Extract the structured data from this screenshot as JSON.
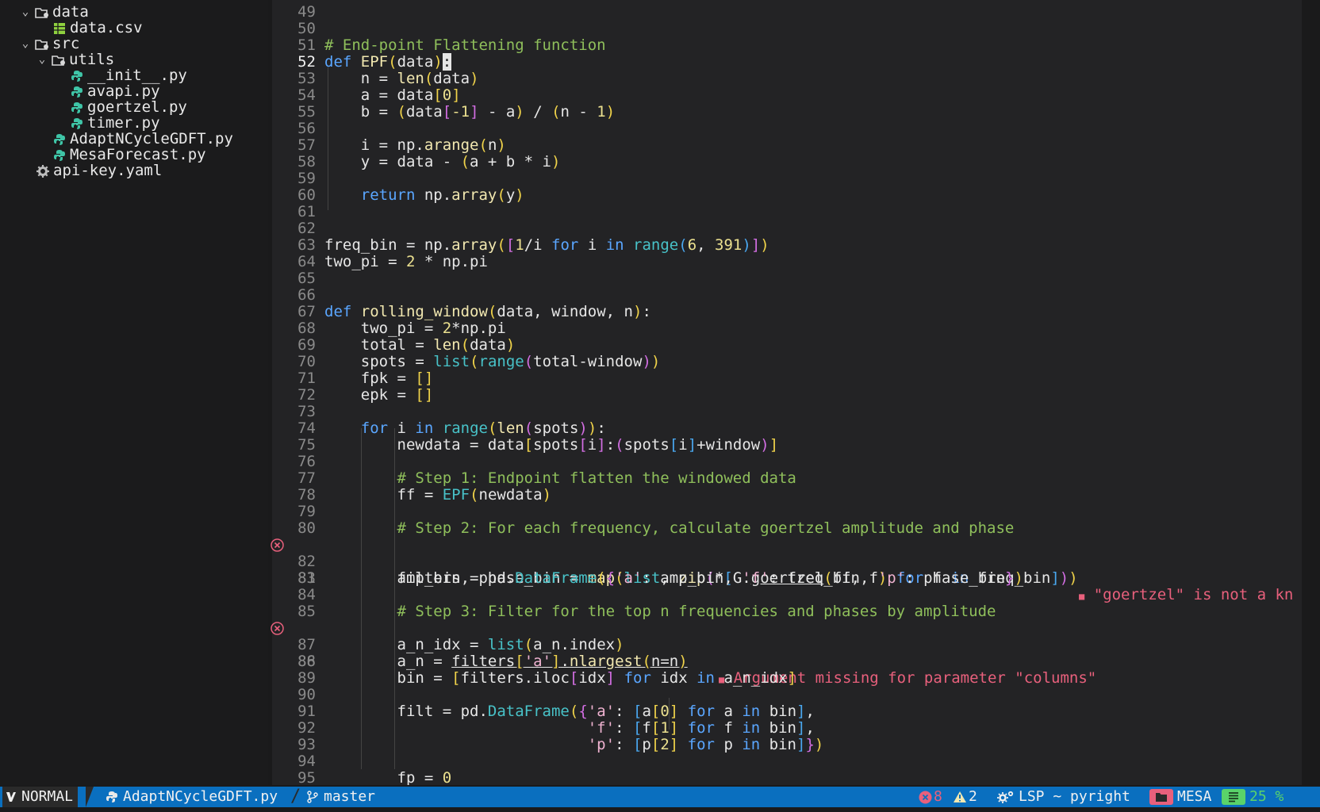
{
  "sidebar": {
    "items": [
      {
        "label": "data",
        "icon": "folder-open-icon",
        "kind": "folder"
      },
      {
        "label": "data.csv",
        "icon": "spreadsheet-icon",
        "kind": "file"
      },
      {
        "label": "src",
        "icon": "folder-open-icon",
        "kind": "folder"
      },
      {
        "label": "utils",
        "icon": "folder-open-icon",
        "kind": "folder"
      },
      {
        "label": "__init__.py",
        "icon": "python-icon",
        "kind": "file"
      },
      {
        "label": "avapi.py",
        "icon": "python-icon",
        "kind": "file"
      },
      {
        "label": "goertzel.py",
        "icon": "python-icon",
        "kind": "file"
      },
      {
        "label": "timer.py",
        "icon": "python-icon",
        "kind": "file"
      },
      {
        "label": "AdaptNCycleGDFT.py",
        "icon": "python-icon",
        "kind": "file"
      },
      {
        "label": "MesaForecast.py",
        "icon": "python-icon",
        "kind": "file"
      },
      {
        "label": "api-key.yaml",
        "icon": "gear-icon",
        "kind": "file"
      }
    ]
  },
  "editor": {
    "current_line": "52",
    "lines": [
      {
        "n": "49",
        "t": ""
      },
      {
        "n": "50",
        "t": ""
      },
      {
        "n": "51",
        "t": "# End-point Flattening function"
      },
      {
        "n": "52",
        "t": "def EPF(data):"
      },
      {
        "n": "53",
        "t": "    n = len(data)"
      },
      {
        "n": "54",
        "t": "    a = data[0]"
      },
      {
        "n": "55",
        "t": "    b = (data[-1] - a) / (n - 1)"
      },
      {
        "n": "56",
        "t": ""
      },
      {
        "n": "57",
        "t": "    i = np.arange(n)"
      },
      {
        "n": "58",
        "t": "    y = data - (a + b * i)"
      },
      {
        "n": "59",
        "t": ""
      },
      {
        "n": "60",
        "t": "    return np.array(y)"
      },
      {
        "n": "61",
        "t": ""
      },
      {
        "n": "62",
        "t": ""
      },
      {
        "n": "63",
        "t": "freq_bin = np.array([1/i for i in range(6, 391)])"
      },
      {
        "n": "64",
        "t": "two_pi = 2 * np.pi"
      },
      {
        "n": "65",
        "t": ""
      },
      {
        "n": "66",
        "t": ""
      },
      {
        "n": "67",
        "t": "def rolling_window(data, window, n):"
      },
      {
        "n": "68",
        "t": "    two_pi = 2*np.pi"
      },
      {
        "n": "69",
        "t": "    total = len(data)"
      },
      {
        "n": "70",
        "t": "    spots = list(range(total-window))"
      },
      {
        "n": "71",
        "t": "    fpk = []"
      },
      {
        "n": "72",
        "t": "    epk = []"
      },
      {
        "n": "73",
        "t": ""
      },
      {
        "n": "74",
        "t": "    for i in range(len(spots)):"
      },
      {
        "n": "75",
        "t": "        newdata = data[spots[i]:(spots[i]+window)]"
      },
      {
        "n": "76",
        "t": ""
      },
      {
        "n": "77",
        "t": "        # Step 1: Endpoint flatten the windowed data"
      },
      {
        "n": "78",
        "t": "        ff = EPF(newdata)"
      },
      {
        "n": "79",
        "t": ""
      },
      {
        "n": "80",
        "t": "        # Step 2: For each frequency, calculate goertzel amplitude and phase"
      },
      {
        "n": "81",
        "t": "        amp_bin, phase_bin = map(list, zip(*[G.goertzel(ff, f) for f in freq_bin]))"
      },
      {
        "n": "82",
        "t": ""
      },
      {
        "n": "83",
        "t": "        filters = pd.DataFrame({'a': amp_bin, 'f': freq_bin, 'p': phase_bin})"
      },
      {
        "n": "84",
        "t": ""
      },
      {
        "n": "85",
        "t": "        # Step 3: Filter for the top n frequencies and phases by amplitude"
      },
      {
        "n": "86",
        "t": "        a_n = filters['a'].nlargest(n=n)"
      },
      {
        "n": "87",
        "t": "        a_n_idx = list(a_n.index)"
      },
      {
        "n": "88",
        "t": ""
      },
      {
        "n": "89",
        "t": "        bin = [filters.iloc[idx] for idx in a_n_idx]"
      },
      {
        "n": "90",
        "t": ""
      },
      {
        "n": "91",
        "t": "        filt = pd.DataFrame({'a': [a[0] for a in bin],"
      },
      {
        "n": "92",
        "t": "                             'f': [f[1] for f in bin],"
      },
      {
        "n": "93",
        "t": "                             'p': [p[2] for p in bin]})"
      },
      {
        "n": "94",
        "t": ""
      },
      {
        "n": "95",
        "t": "        fp = 0"
      }
    ],
    "diagnostics": {
      "81": "\"goertzel\" is not a kn",
      "86": "Argument missing for parameter \"columns\""
    }
  },
  "statusbar": {
    "mode": "NORMAL",
    "file": "AdaptNCycleGDFT.py",
    "branch": "master",
    "errors": "8",
    "warnings": "2",
    "lsp": "LSP ~ pyright",
    "project": "MESA",
    "progress": "25 %"
  },
  "colors": {
    "background": "#1a1a1b",
    "editor_bg": "#232325",
    "statusbar_bg": "#0a6fbf",
    "keyword": "#5aa6ff",
    "comment": "#8fbf5b",
    "error": "#e8607c",
    "python_icon": "#3fc5a7"
  }
}
